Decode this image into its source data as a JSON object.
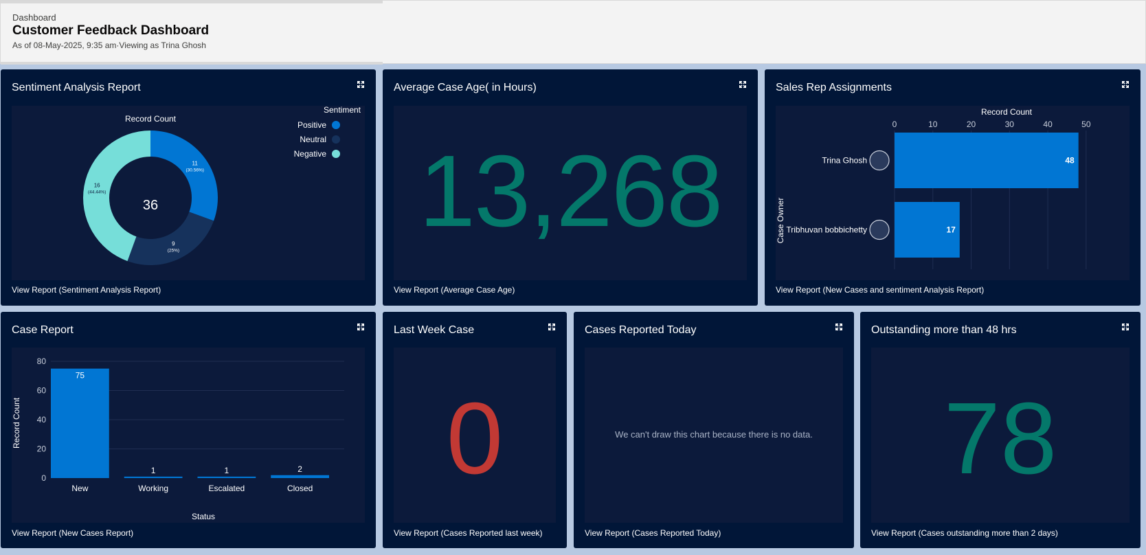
{
  "header": {
    "label": "Dashboard",
    "title": "Customer Feedback Dashboard",
    "subtitle": "As of 08-May-2025, 9:35 am·Viewing as Trina Ghosh"
  },
  "colors": {
    "card_bg": "#011638",
    "body_bg": "#0c1a3b",
    "positive": "#0176d3",
    "neutral": "#16325c",
    "negative": "#76ded9",
    "teal_number": "#04786a",
    "red_number": "#c23934"
  },
  "cards": {
    "sentiment": {
      "title": "Sentiment Analysis Report",
      "link": "View Report (Sentiment Analysis Report)",
      "chart_caption": "Record Count",
      "legend_title": "Sentiment",
      "center_total": "36",
      "icon": "expand-icon"
    },
    "avg_age": {
      "title": "Average Case Age( in Hours)",
      "value": "13,268",
      "link": "View Report (Average Case Age)"
    },
    "sales_rep": {
      "title": "Sales Rep Assignments",
      "link": "View Report (New Cases and sentiment Analysis Report)",
      "xlabel": "Record Count",
      "ylabel": "Case Owner"
    },
    "case_report": {
      "title": "Case Report",
      "link": "View Report (New Cases Report)",
      "xlabel": "Status",
      "ylabel": "Record Count"
    },
    "last_week": {
      "title": "Last Week Case",
      "value": "0",
      "link": "View Report (Cases Reported last week)"
    },
    "today": {
      "title": "Cases Reported Today",
      "message": "We can't draw this chart because there is no data.",
      "link": "View Report (Cases Reported Today)"
    },
    "outstanding": {
      "title": "Outstanding more than 48 hrs",
      "value": "78",
      "link": "View Report (Cases outstanding more than 2 days)"
    }
  },
  "chart_data": [
    {
      "type": "pie",
      "variant": "donut",
      "title": "Record Count",
      "legend_title": "Sentiment",
      "legend_position": "top-right",
      "categories": [
        "Positive",
        "Neutral",
        "Negative"
      ],
      "values": [
        11,
        9,
        16
      ],
      "labels": [
        "30.56%",
        "25%",
        "44.44%"
      ],
      "colors": [
        "#0176d3",
        "#16325c",
        "#76ded9"
      ],
      "total": 36
    },
    {
      "type": "bar",
      "orientation": "horizontal",
      "xlabel": "Record Count",
      "ylabel": "Case Owner",
      "categories": [
        "Trina Ghosh",
        "Tribhuvan bobbichetty"
      ],
      "values": [
        48,
        17
      ],
      "xticks": [
        0,
        10,
        20,
        30,
        40,
        50
      ],
      "xlim": [
        0,
        52
      ],
      "grid": true
    },
    {
      "type": "bar",
      "orientation": "vertical",
      "xlabel": "Status",
      "ylabel": "Record Count",
      "categories": [
        "New",
        "Working",
        "Escalated",
        "Closed"
      ],
      "values": [
        75,
        1,
        1,
        2
      ],
      "yticks": [
        0,
        20,
        40,
        60,
        80
      ],
      "ylim": [
        0,
        80
      ],
      "grid": true
    }
  ]
}
